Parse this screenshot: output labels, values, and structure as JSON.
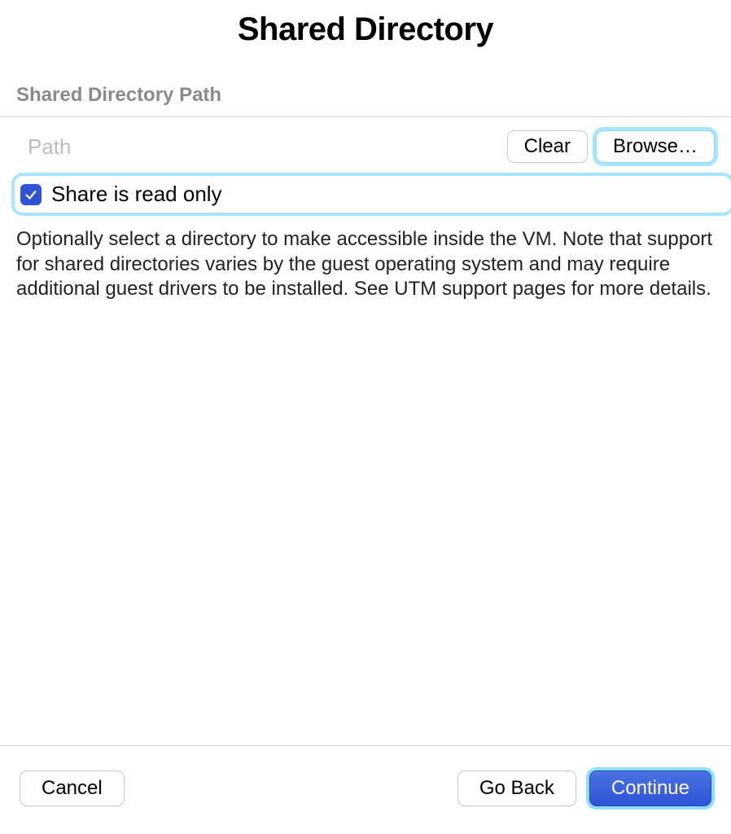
{
  "title": "Shared Directory",
  "section": {
    "header": "Shared Directory Path",
    "path_placeholder": "Path",
    "clear_label": "Clear",
    "browse_label": "Browse…",
    "read_only_label": "Share is read only",
    "read_only_checked": true,
    "description": "Optionally select a directory to make accessible inside the VM. Note that support for shared directories varies by the guest operating system and may require additional guest drivers to be installed. See UTM support pages for more details."
  },
  "footer": {
    "cancel_label": "Cancel",
    "go_back_label": "Go Back",
    "continue_label": "Continue"
  }
}
